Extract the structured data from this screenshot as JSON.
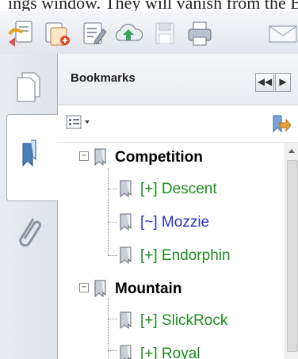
{
  "window": {
    "caption_fragment": "ings window. They will vanish from the Bookmarks"
  },
  "toolbar": {
    "buttons": [
      {
        "name": "create-pdf-icon"
      },
      {
        "name": "combine-files-icon"
      },
      {
        "name": "edit-document-icon"
      },
      {
        "name": "cloud-upload-icon"
      },
      {
        "name": "save-icon"
      },
      {
        "name": "print-icon"
      },
      {
        "name": "email-icon"
      }
    ]
  },
  "left_panel": {
    "items": [
      "page-thumbnails-icon",
      "bookmarks-icon",
      "attachments-icon"
    ],
    "active": "bookmarks-icon"
  },
  "bookmarks_panel": {
    "title": "Bookmarks",
    "nav_left": "◀◀",
    "nav_right": "▶",
    "options_icon": "options-menu-icon",
    "action_icon": "bookmark-action-icon",
    "tree": [
      {
        "label": "Competition",
        "type": "group",
        "expanded": true,
        "children": [
          {
            "label": "[+] Descent",
            "color": "#1e8b1e"
          },
          {
            "label": "[~] Mozzie",
            "color": "#2b32c9"
          },
          {
            "label": "[+] Endorphin",
            "color": "#1e8b1e"
          }
        ]
      },
      {
        "label": "Mountain",
        "type": "group",
        "expanded": true,
        "children": [
          {
            "label": "[+] SlickRock",
            "color": "#1e8b1e"
          },
          {
            "label": "[+] Royal",
            "color": "#1e8b1e",
            "partially_visible": true
          }
        ]
      }
    ],
    "toggle_expanded": "−"
  }
}
